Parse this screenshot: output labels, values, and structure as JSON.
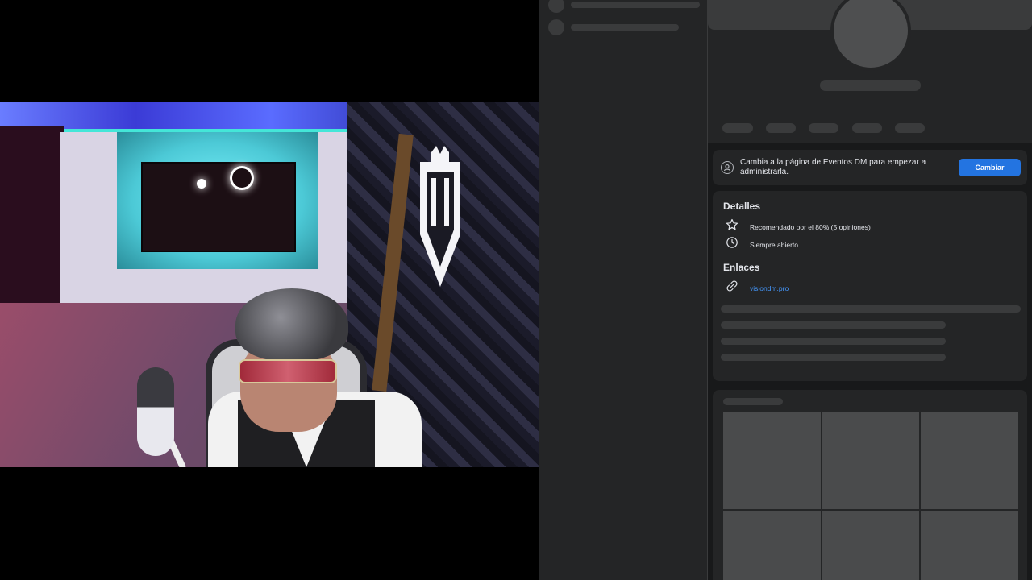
{
  "notice": {
    "text": "Cambia a la página de Eventos DM para empezar a administrarla.",
    "button_label": "Cambiar"
  },
  "details": {
    "title": "Detalles",
    "recommendation": "Recomendado por el 80% (5 opiniones)",
    "hours": "Siempre abierto"
  },
  "links": {
    "title": "Enlaces",
    "website": "visiondm.pro"
  },
  "colors": {
    "panel": "#242526",
    "background": "#18191a",
    "skeleton": "#3a3b3c",
    "accent": "#2374e1",
    "link": "#4599ff"
  },
  "icons": {
    "notice": "user-circle-icon",
    "recommendation": "star-icon",
    "hours": "clock-icon",
    "website": "link-icon"
  }
}
